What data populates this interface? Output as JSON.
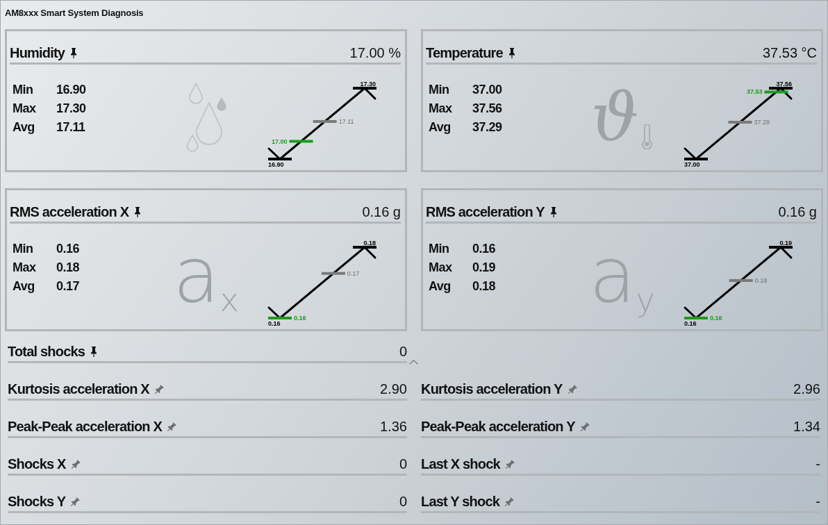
{
  "window": {
    "title": "AM8xxx Smart System Diagnosis"
  },
  "cards": [
    {
      "title": "Humidity",
      "pinned": true,
      "value": "17.00 %",
      "watermark": {
        "kind": "droplets"
      },
      "stats": [
        {
          "label": "Min",
          "value": "16.90"
        },
        {
          "label": "Max",
          "value": "17.30"
        },
        {
          "label": "Avg",
          "value": "17.11"
        }
      ],
      "range": {
        "min": "16.90",
        "max": "17.30",
        "average": {
          "label": "17.11",
          "level": 0.53
        },
        "current": "17.00"
      }
    },
    {
      "title": "Temperature",
      "pinned": true,
      "value": "37.53 °C",
      "watermark": {
        "kind": "temperature",
        "symbol": "ϑ"
      },
      "stats": [
        {
          "label": "Min",
          "value": "37.00"
        },
        {
          "label": "Max",
          "value": "37.56"
        },
        {
          "label": "Avg",
          "value": "37.29"
        }
      ],
      "range": {
        "min": "37.00",
        "max": "37.56",
        "average": {
          "label": "37.29",
          "level": 0.52
        },
        "current": "37.53"
      }
    },
    {
      "title": "RMS acceleration X",
      "pinned": true,
      "value": "0.16 g",
      "watermark": {
        "kind": "acceleration",
        "symbol": "a$_{x}$"
      },
      "stats": [
        {
          "label": "Min",
          "value": "0.16"
        },
        {
          "label": "Max",
          "value": "0.18"
        },
        {
          "label": "Avg",
          "value": "0.17"
        }
      ],
      "range": {
        "min": "0.16",
        "max": "0.18",
        "average": {
          "label": "0.17",
          "level": 0.63
        },
        "current": "0.16"
      }
    },
    {
      "title": "RMS acceleration Y",
      "pinned": true,
      "value": "0.16 g",
      "watermark": {
        "kind": "acceleration",
        "symbol": "a$_{y}$"
      },
      "stats": [
        {
          "label": "Min",
          "value": "0.16"
        },
        {
          "label": "Max",
          "value": "0.19"
        },
        {
          "label": "Avg",
          "value": "0.18"
        }
      ],
      "range": {
        "min": "0.16",
        "max": "0.19",
        "average": {
          "label": "0.18",
          "level": 0.53
        },
        "current": "0.16"
      }
    }
  ],
  "summary": {
    "label": "Total shocks",
    "pinned": true,
    "value": "0",
    "expanded": true
  },
  "metrics": [
    {
      "label": "Kurtosis acceleration X",
      "pinned": false,
      "value": "2.90"
    },
    {
      "label": "Kurtosis acceleration Y",
      "pinned": false,
      "value": "2.96"
    },
    {
      "label": "Peak-Peak acceleration X",
      "pinned": false,
      "value": "1.36"
    },
    {
      "label": "Peak-Peak acceleration Y",
      "pinned": false,
      "value": "1.34"
    },
    {
      "label": "Shocks X",
      "pinned": false,
      "value": "0"
    },
    {
      "label": "Last X shock",
      "pinned": false,
      "value": "-"
    },
    {
      "label": "Shocks Y",
      "pinned": false,
      "value": "0"
    },
    {
      "label": "Last Y shock",
      "pinned": false,
      "value": "-"
    }
  ]
}
